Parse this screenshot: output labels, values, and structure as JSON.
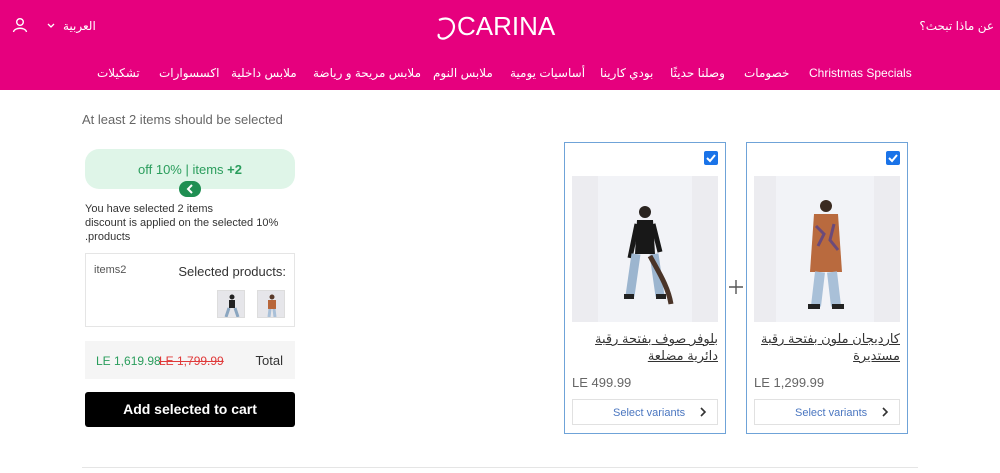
{
  "header": {
    "search_label": "عن ماذا تبحث؟",
    "brand": "CARINA",
    "language": "العربية",
    "nav": [
      "Christmas Specials",
      "خصومات",
      "وصلنا حديثًا",
      "بودي كارينا",
      "أساسيات يومية",
      "ملابس النوم",
      "ملابس مريحة و رياضة",
      "ملابس داخلية",
      "اكسسوارات",
      "تشكيلات"
    ]
  },
  "bundle": {
    "hint": "At least 2 items should be selected",
    "pill_text": "off 10% | items",
    "pill_count": "+2",
    "info_line1": "You have selected 2 items",
    "info_line2": "discount is applied on the selected 10%",
    "info_line3": ".products",
    "selected_label": "Selected products:",
    "selected_count": "items2",
    "total_label": "Total",
    "total_new": "LE 1,619.98",
    "total_old": "LE 1,799.99",
    "add_button": "Add selected to cart"
  },
  "products": [
    {
      "title": "كارديجان ملون بفتحة رقبة مستديرة",
      "price": "LE 1,299.99",
      "variants": "Select variants",
      "checked": true
    },
    {
      "title": "بلوفر صوف بفتحة رقبة دائرية مضلعة",
      "price": "LE 499.99",
      "variants": "Select variants",
      "checked": true
    }
  ],
  "colors": {
    "brand_pink": "#e6007e",
    "discount_green": "#2a9d5c",
    "strike_red": "#e03a3a",
    "accent_blue": "#1a73e8"
  }
}
